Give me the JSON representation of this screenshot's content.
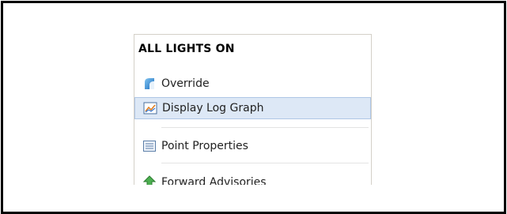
{
  "menu": {
    "header": "ALL LIGHTS ON",
    "items": [
      {
        "label": "Override",
        "icon": "override-icon"
      },
      {
        "label": "Display Log Graph",
        "icon": "log-graph-icon",
        "selected": true
      },
      {
        "label": "Point Properties",
        "icon": "properties-icon"
      },
      {
        "label": "Forward Advisories",
        "icon": "advisory-icon"
      }
    ]
  },
  "colors": {
    "selection_bg": "#dde8f6",
    "selection_border": "#aec6e6",
    "frame_border": "#000000"
  }
}
